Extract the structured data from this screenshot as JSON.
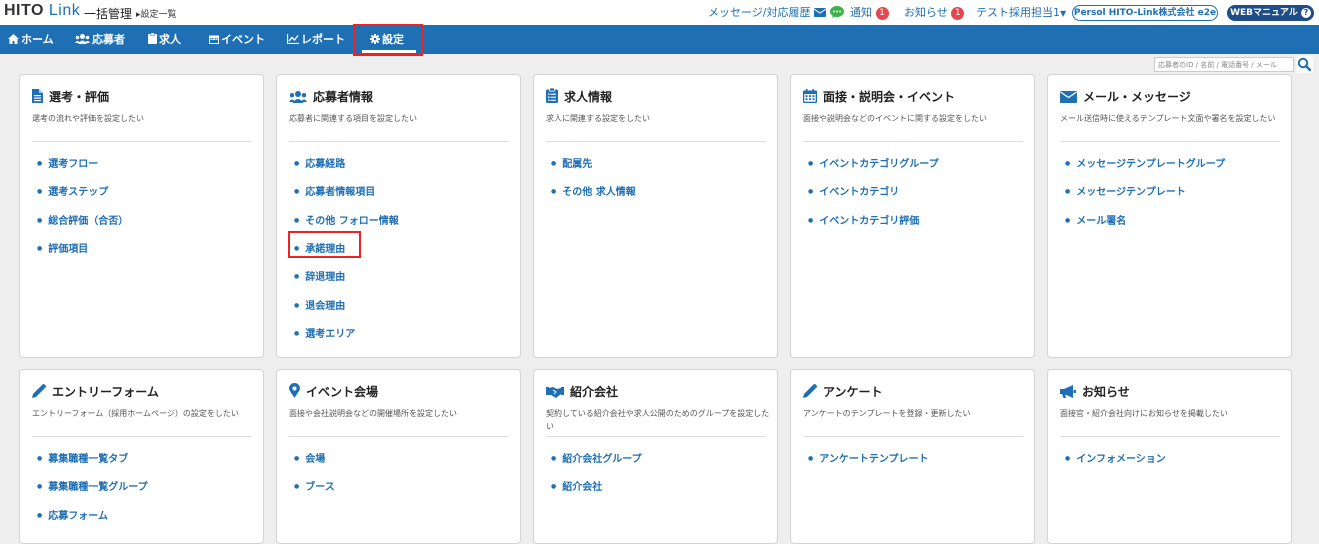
{
  "header": {
    "logo_main": "HITO",
    "logo_sub": "Link",
    "page_title": "一括管理",
    "breadcrumb": "設定一覧",
    "message_link": "メッセージ/対応履歴",
    "notification": "通知",
    "notification_count": "1",
    "news": "お知らせ",
    "news_count": "1",
    "user": "テスト採用担当1",
    "company": "Persol HITO-Link株式会社 e2e",
    "manual": "WEBマニュアル"
  },
  "nav": {
    "home": "ホーム",
    "applicants": "応募者",
    "jobs": "求人",
    "events": "イベント",
    "reports": "レポート",
    "settings": "設定",
    "search_placeholder": "応募者のID / 名前 / 電話番号 / メール"
  },
  "cards": [
    {
      "title": "選考・評価",
      "desc": "選考の流れや評価を設定したい",
      "links": [
        "選考フロー",
        "選考ステップ",
        "総合評価（合否）",
        "評価項目"
      ]
    },
    {
      "title": "応募者情報",
      "desc": "応募者に関連する項目を設定したい",
      "links": [
        "応募経路",
        "応募者情報項目",
        "その他 フォロー情報",
        "承諾理由",
        "辞退理由",
        "退会理由",
        "選考エリア"
      ]
    },
    {
      "title": "求人情報",
      "desc": "求人に関連する設定をしたい",
      "links": [
        "配属先",
        "その他 求人情報"
      ]
    },
    {
      "title": "面接・説明会・イベント",
      "desc": "面接や説明会などのイベントに関する設定をしたい",
      "links": [
        "イベントカテゴリグループ",
        "イベントカテゴリ",
        "イベントカテゴリ評価"
      ]
    },
    {
      "title": "メール・メッセージ",
      "desc": "メール送信時に使えるテンプレート文面や署名を設定したい",
      "links": [
        "メッセージテンプレートグループ",
        "メッセージテンプレート",
        "メール署名"
      ]
    },
    {
      "title": "エントリーフォーム",
      "desc": "エントリーフォーム（採用ホームページ）の設定をしたい",
      "links": [
        "募集職種一覧タブ",
        "募集職種一覧グループ",
        "応募フォーム"
      ]
    },
    {
      "title": "イベント会場",
      "desc": "面接や会社説明会などの開催場所を設定したい",
      "links": [
        "会場",
        "ブース"
      ]
    },
    {
      "title": "紹介会社",
      "desc": "契約している紹介会社や求人公開のためのグループを設定したい",
      "links": [
        "紹介会社グループ",
        "紹介会社"
      ]
    },
    {
      "title": "アンケート",
      "desc": "アンケートのテンプレートを登録・更新したい",
      "links": [
        "アンケートテンプレート"
      ]
    },
    {
      "title": "お知らせ",
      "desc": "面接官・紹介会社向けにお知らせを掲載したい",
      "links": [
        "インフォメーション"
      ]
    }
  ],
  "icons": {
    "card_icons": [
      "document-icon",
      "users-icon",
      "clipboard-list-icon",
      "calendar-icon",
      "envelope-icon",
      "pencil-icon",
      "map-marker-icon",
      "handshake-icon",
      "pencil-icon",
      "megaphone-icon"
    ]
  },
  "colors": {
    "primary": "#1f6fb4",
    "highlight": "#e22222",
    "badge": "#e4474d"
  }
}
